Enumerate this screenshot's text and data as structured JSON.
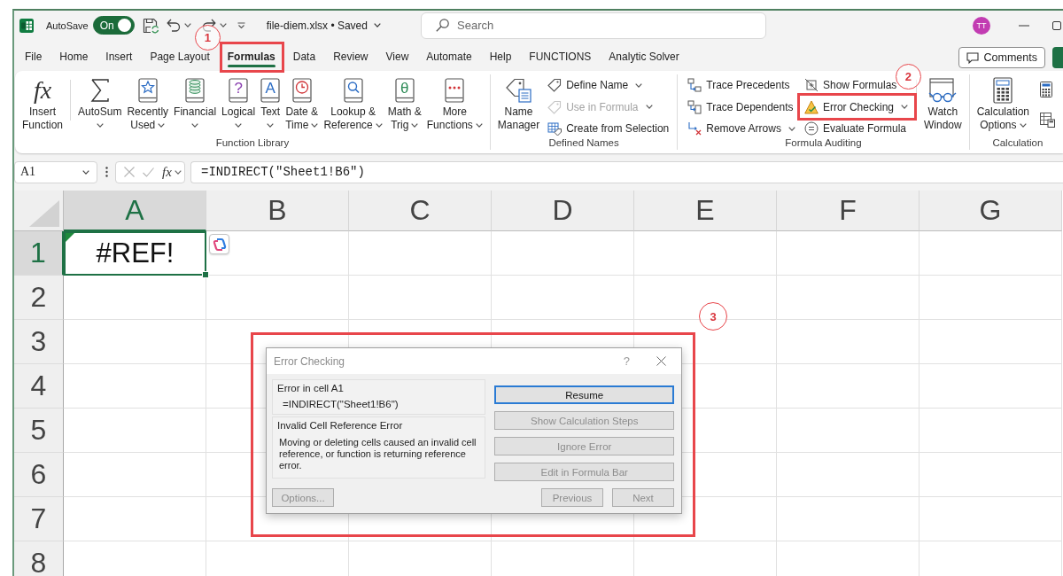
{
  "title_bar": {
    "autosave": {
      "label": "AutoSave",
      "state_text": "On",
      "on": true
    },
    "document_title": "file-diem.xlsx • Saved",
    "search": {
      "placeholder": "Search"
    },
    "user_initials": "TT"
  },
  "ribbon_tabs": [
    {
      "label": "File",
      "selected": false
    },
    {
      "label": "Home",
      "selected": false
    },
    {
      "label": "Insert",
      "selected": false
    },
    {
      "label": "Page Layout",
      "selected": false
    },
    {
      "label": "Formulas",
      "selected": true,
      "annotation": "1"
    },
    {
      "label": "Data",
      "selected": false
    },
    {
      "label": "Review",
      "selected": false
    },
    {
      "label": "View",
      "selected": false
    },
    {
      "label": "Automate",
      "selected": false
    },
    {
      "label": "Help",
      "selected": false
    },
    {
      "label": "FUNCTIONS",
      "selected": false
    },
    {
      "label": "Analytic Solver",
      "selected": false
    }
  ],
  "comments_button": "Comments",
  "ribbon": {
    "groups": [
      {
        "label": "Function Library",
        "columns": [
          {
            "kind": "large",
            "lines": [
              "Insert",
              "Function"
            ],
            "glyph": "fx",
            "dropdown": false
          },
          {
            "kind": "divider"
          },
          {
            "kind": "large",
            "lines": [
              "AutoSum"
            ],
            "dropdown": true
          },
          {
            "kind": "large",
            "lines": [
              "Recently",
              "Used"
            ],
            "dropdown": true
          },
          {
            "kind": "large",
            "lines": [
              "Financial"
            ],
            "dropdown": true
          },
          {
            "kind": "large",
            "lines": [
              "Logical"
            ],
            "glyph": "?",
            "dropdown": true
          },
          {
            "kind": "large",
            "lines": [
              "Text"
            ],
            "glyph": "A",
            "dropdown": true
          },
          {
            "kind": "large",
            "lines": [
              "Date &",
              "Time"
            ],
            "dropdown": true
          },
          {
            "kind": "large",
            "lines": [
              "Lookup &",
              "Reference"
            ],
            "dropdown": true
          },
          {
            "kind": "large",
            "lines": [
              "Math &",
              "Trig"
            ],
            "glyph": "θ",
            "dropdown": true
          },
          {
            "kind": "large",
            "lines": [
              "More",
              "Functions"
            ],
            "dropdown": true
          }
        ]
      },
      {
        "label": "Defined Names",
        "columns": [
          {
            "kind": "large",
            "lines": [
              "Name",
              "Manager"
            ],
            "dropdown": false
          },
          {
            "kind": "stack",
            "items": [
              {
                "kind": "command",
                "label": "Define Name",
                "dropdown": true,
                "disabled": false
              },
              {
                "kind": "command",
                "label": "Use in Formula",
                "dropdown": true,
                "disabled": true
              },
              {
                "kind": "command",
                "label": "Create from Selection",
                "dropdown": false,
                "disabled": false
              }
            ]
          }
        ]
      },
      {
        "label": "Formula Auditing",
        "columns": [
          {
            "kind": "stack",
            "items": [
              {
                "kind": "command",
                "label": "Trace Precedents",
                "dropdown": false,
                "disabled": false
              },
              {
                "kind": "command",
                "label": "Trace Dependents",
                "dropdown": false,
                "disabled": false
              },
              {
                "kind": "command",
                "label": "Remove Arrows",
                "dropdown": true,
                "disabled": false
              }
            ]
          },
          {
            "kind": "stack",
            "items": [
              {
                "kind": "command",
                "label": "Show Formulas",
                "dropdown": false,
                "disabled": false
              },
              {
                "kind": "command",
                "label": "Error Checking",
                "dropdown": true,
                "disabled": false,
                "annotation": "2"
              },
              {
                "kind": "command",
                "label": "Evaluate Formula",
                "dropdown": false,
                "disabled": false
              }
            ]
          },
          {
            "kind": "divider"
          },
          {
            "kind": "large",
            "lines": [
              "Watch",
              "Window"
            ],
            "dropdown": false
          }
        ]
      },
      {
        "label": "Calculation",
        "columns": [
          {
            "kind": "large",
            "lines": [
              "Calculation",
              "Options"
            ],
            "dropdown": true
          },
          {
            "kind": "stack",
            "items": [
              {
                "kind": "icon"
              },
              {
                "kind": "icon"
              }
            ]
          }
        ]
      }
    ]
  },
  "formula_bar": {
    "name_box": "A1",
    "insert_function": "fx",
    "formula": "=INDIRECT(\"Sheet1!B6\")"
  },
  "grid": {
    "columns": [
      {
        "label": "A",
        "selected": true
      },
      {
        "label": "B",
        "selected": false
      },
      {
        "label": "C",
        "selected": false
      },
      {
        "label": "D",
        "selected": false
      },
      {
        "label": "E",
        "selected": false
      },
      {
        "label": "F",
        "selected": false
      },
      {
        "label": "G",
        "selected": false
      }
    ],
    "rows": [
      {
        "label": "1",
        "selected": true,
        "cells": [
          {
            "value": "#REF!",
            "active": true,
            "error_flag": true
          }
        ]
      },
      {
        "label": "2",
        "selected": false
      },
      {
        "label": "3",
        "selected": false
      },
      {
        "label": "4",
        "selected": false
      },
      {
        "label": "5",
        "selected": false
      },
      {
        "label": "6",
        "selected": false
      },
      {
        "label": "7",
        "selected": false
      },
      {
        "label": "8",
        "selected": false
      }
    ]
  },
  "dialog": {
    "title": "Error Checking",
    "help": "?",
    "annotation": "3",
    "location_label": "Error in cell A1",
    "formula": "=INDIRECT(\"Sheet1!B6\")",
    "error_title": "Invalid Cell Reference Error",
    "description": "Moving or deleting cells caused an invalid cell reference, or function is returning reference error.",
    "actions": [
      {
        "label": "Resume",
        "default": true,
        "disabled": false
      },
      {
        "label": "Show Calculation Steps",
        "default": false,
        "disabled": true
      },
      {
        "label": "Ignore Error",
        "default": false,
        "disabled": true
      },
      {
        "label": "Edit in Formula Bar",
        "default": false,
        "disabled": true
      }
    ],
    "footer_buttons": [
      {
        "label": "Options...",
        "disabled": true
      },
      {
        "label": "Previous",
        "disabled": true
      },
      {
        "label": "Next",
        "disabled": true
      }
    ]
  }
}
